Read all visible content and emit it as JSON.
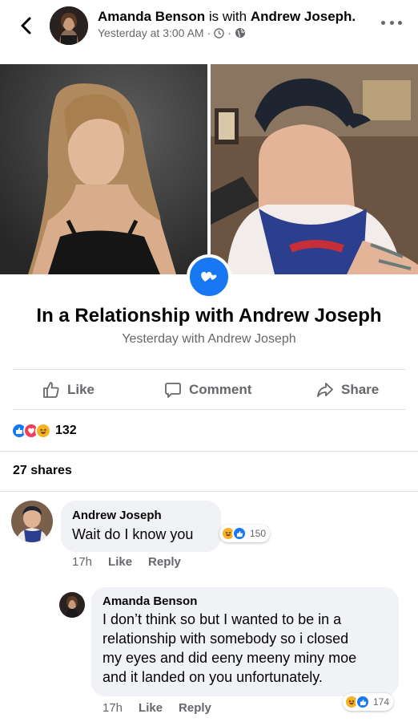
{
  "post": {
    "author": "Amanda Benson",
    "with_text": "is with",
    "tagged": "Andrew Joseph.",
    "time": "Yesterday at 3:00 AM",
    "separator": "·"
  },
  "event": {
    "title": "In a Relationship with Andrew Joseph",
    "subtitle": "Yesterday with Andrew Joseph"
  },
  "actions": {
    "like": "Like",
    "comment": "Comment",
    "share": "Share"
  },
  "reactions": {
    "count": "132"
  },
  "shares_text": "27 shares",
  "comments": [
    {
      "author": "Andrew Joseph",
      "text": "Wait do I know you",
      "time": "17h",
      "like": "Like",
      "reply": "Reply",
      "reaction_count": "150"
    },
    {
      "author": "Amanda Benson",
      "lines": [
        "I don’t think so but I wanted to be in a",
        "relationship with somebody so i closed",
        "my eyes and did eeny meeny miny moe",
        "and it landed on you unfortunately."
      ],
      "time": "17h",
      "like": "Like",
      "reply": "Reply",
      "reaction_count": "174"
    }
  ],
  "colors": {
    "accent": "#1877f2",
    "love": "#f33e58",
    "haha": "#f7b125",
    "secondary_text": "#65676b"
  }
}
